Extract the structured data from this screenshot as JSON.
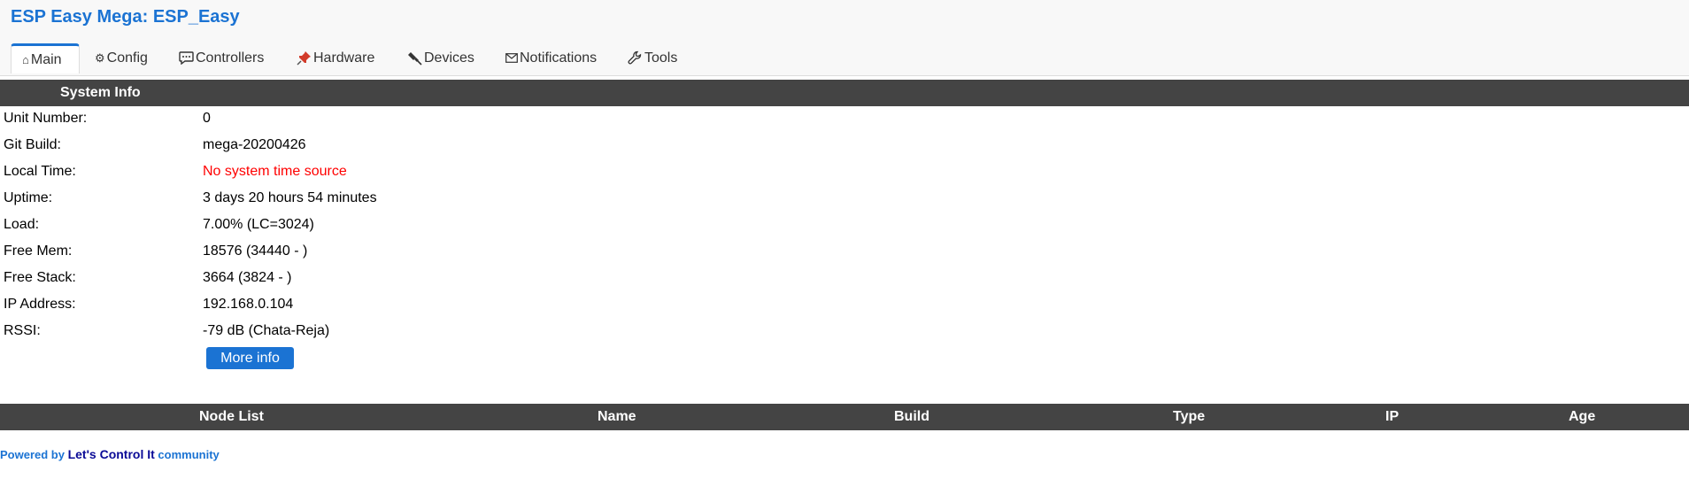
{
  "app": {
    "title": "ESP Easy Mega: ESP_Easy"
  },
  "tabs": [
    {
      "label": "Main",
      "icon": "home-icon",
      "active": true
    },
    {
      "label": "Config",
      "icon": "gear-icon"
    },
    {
      "label": "Controllers",
      "icon": "chat-bubble-icon"
    },
    {
      "label": "Hardware",
      "icon": "pushpin-icon"
    },
    {
      "label": "Devices",
      "icon": "plug-icon"
    },
    {
      "label": "Notifications",
      "icon": "envelope-icon"
    },
    {
      "label": "Tools",
      "icon": "wrench-icon"
    }
  ],
  "system_info": {
    "heading": "System Info",
    "rows": [
      {
        "label": "Unit Number:",
        "value": "0"
      },
      {
        "label": "Git Build:",
        "value": "mega-20200426"
      },
      {
        "label": "Local Time:",
        "value": "No system time source",
        "warn": true
      },
      {
        "label": "Uptime:",
        "value": "3 days 20 hours 54 minutes"
      },
      {
        "label": "Load:",
        "value": "7.00% (LC=3024)"
      },
      {
        "label": "Free Mem:",
        "value": "18576 (34440 - )"
      },
      {
        "label": "Free Stack:",
        "value": "3664 (3824 - )"
      },
      {
        "label": "IP Address:",
        "value": "192.168.0.104"
      },
      {
        "label": "RSSI:",
        "value": "-79 dB (Chata-Reja)"
      }
    ],
    "more_info_label": "More info"
  },
  "node_list": {
    "columns": [
      "Node List",
      "Name",
      "Build",
      "Type",
      "IP",
      "Age"
    ]
  },
  "footer": {
    "prefix": "Powered by ",
    "link": "Let's Control It",
    "suffix": " community"
  },
  "colors": {
    "accent": "#1b73d3",
    "section_bar": "#444444",
    "warning": "#ff0000"
  }
}
